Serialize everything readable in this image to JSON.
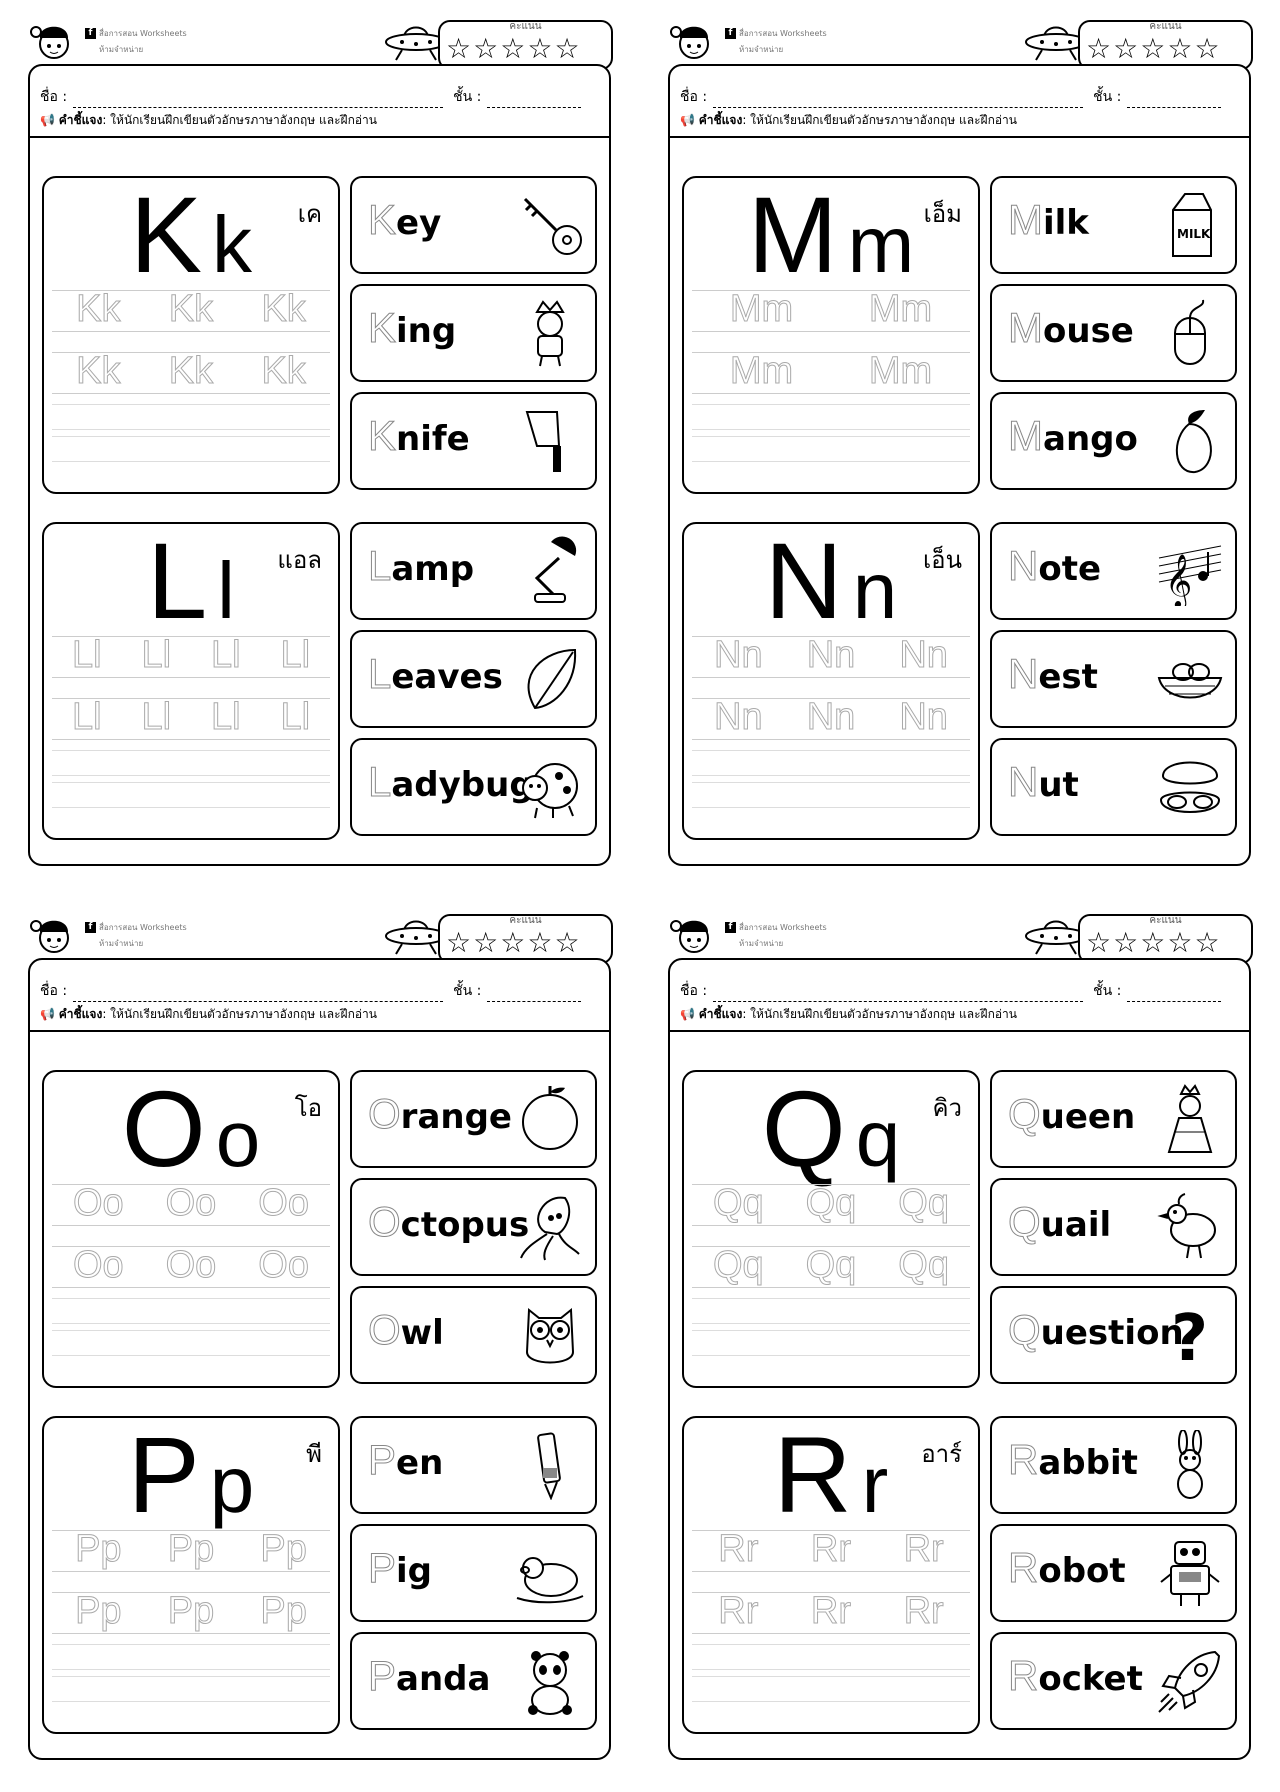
{
  "header": {
    "brand_line1": "สื่อการสอน  Worksheets",
    "brand_line2": "ห้ามจำหน่าย",
    "score_label": "คะแนน",
    "fb_icon": "f",
    "name_label": "ชื่อ :",
    "class_label": "ชั้น :",
    "instruction_label": "คำชี้แจง",
    "instruction_text": ": ให้นักเรียนฝึกเขียนตัวอักษรภาษาอังกฤษ และฝึกอ่าน"
  },
  "sheets": [
    {
      "letters": [
        {
          "upper": "K",
          "lower": "k",
          "thai": "เค",
          "trace": [
            "Kk",
            "Kk",
            "Kk"
          ],
          "words": [
            {
              "first": "K",
              "rest": "ey",
              "icon": "key-icon"
            },
            {
              "first": "K",
              "rest": "ing",
              "icon": "king-icon"
            },
            {
              "first": "K",
              "rest": "nife",
              "icon": "knife-icon"
            }
          ]
        },
        {
          "upper": "L",
          "lower": "l",
          "thai": "แอล",
          "trace": [
            "Ll",
            "Ll",
            "Ll",
            "Ll"
          ],
          "words": [
            {
              "first": "L",
              "rest": "amp",
              "icon": "lamp-icon"
            },
            {
              "first": "L",
              "rest": "eaves",
              "icon": "leaf-icon"
            },
            {
              "first": "L",
              "rest": "adybug",
              "icon": "ladybug-icon"
            }
          ]
        }
      ]
    },
    {
      "letters": [
        {
          "upper": "M",
          "lower": "m",
          "thai": "เอ็ม",
          "trace": [
            "Mm",
            "Mm"
          ],
          "words": [
            {
              "first": "M",
              "rest": "ilk",
              "icon": "milk-icon"
            },
            {
              "first": "M",
              "rest": "ouse",
              "icon": "mouse-icon"
            },
            {
              "first": "M",
              "rest": "ango",
              "icon": "mango-icon"
            }
          ]
        },
        {
          "upper": "N",
          "lower": "n",
          "thai": "เอ็น",
          "trace": [
            "Nn",
            "Nn",
            "Nn"
          ],
          "words": [
            {
              "first": "N",
              "rest": "ote",
              "icon": "music-note-icon"
            },
            {
              "first": "N",
              "rest": "est",
              "icon": "nest-icon"
            },
            {
              "first": "N",
              "rest": "ut",
              "icon": "nut-icon"
            }
          ]
        }
      ]
    },
    {
      "letters": [
        {
          "upper": "O",
          "lower": "o",
          "thai": "โอ",
          "trace": [
            "Oo",
            "Oo",
            "Oo"
          ],
          "words": [
            {
              "first": "O",
              "rest": "range",
              "icon": "orange-icon"
            },
            {
              "first": "O",
              "rest": "ctopus",
              "icon": "octopus-icon"
            },
            {
              "first": "O",
              "rest": "wl",
              "icon": "owl-icon"
            }
          ]
        },
        {
          "upper": "P",
          "lower": "p",
          "thai": "พี",
          "trace": [
            "Pp",
            "Pp",
            "Pp"
          ],
          "words": [
            {
              "first": "P",
              "rest": "en",
              "icon": "pen-icon"
            },
            {
              "first": "P",
              "rest": "ig",
              "icon": "pig-icon"
            },
            {
              "first": "P",
              "rest": "anda",
              "icon": "panda-icon"
            }
          ]
        }
      ]
    },
    {
      "letters": [
        {
          "upper": "Q",
          "lower": "q",
          "thai": "คิว",
          "trace": [
            "Qq",
            "Qq",
            "Qq"
          ],
          "words": [
            {
              "first": "Q",
              "rest": "ueen",
              "icon": "queen-icon"
            },
            {
              "first": "Q",
              "rest": "uail",
              "icon": "quail-icon"
            },
            {
              "first": "Q",
              "rest": "uestion",
              "icon": "question-mark-icon"
            }
          ]
        },
        {
          "upper": "R",
          "lower": "r",
          "thai": "อาร์",
          "trace": [
            "Rr",
            "Rr",
            "Rr"
          ],
          "words": [
            {
              "first": "R",
              "rest": "abbit",
              "icon": "rabbit-icon"
            },
            {
              "first": "R",
              "rest": "obot",
              "icon": "robot-icon"
            },
            {
              "first": "R",
              "rest": "ocket",
              "icon": "rocket-icon"
            }
          ]
        }
      ]
    }
  ]
}
